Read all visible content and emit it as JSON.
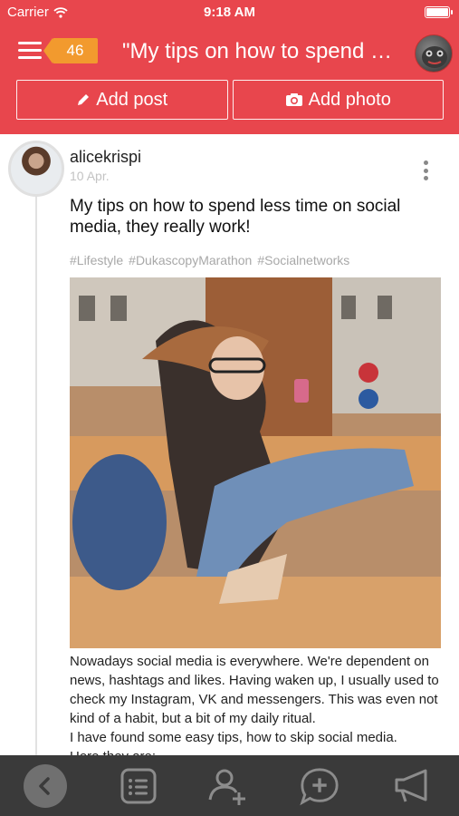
{
  "status_bar": {
    "carrier": "Carrier",
    "time": "9:18 AM"
  },
  "nav": {
    "badge_count": "46",
    "title": "\"My tips on how to spend less time on social media, they really work!\""
  },
  "actions": {
    "add_post": "Add post",
    "add_photo": "Add photo"
  },
  "post": {
    "username": "alicekrispi",
    "date": "10 Apr.",
    "title": "My tips on how to spend less time on social media, they really work!",
    "tags": [
      "#Lifestyle",
      "#DukascopyMarathon",
      "#Socialnetworks"
    ],
    "body": "Nowadays social media is everywhere. We're dependent on news, hashtags and likes. Having waken up, I usually used to check my Instagram, VK and messengers. This was even not kind of a habit, but a bit of my daily ritual.\nI have found some easy tips, how to skip social media.\nHere they are:"
  },
  "colors": {
    "header": "#e8464d",
    "badge": "#f29a2e",
    "tabbar": "#3a3a3a"
  }
}
